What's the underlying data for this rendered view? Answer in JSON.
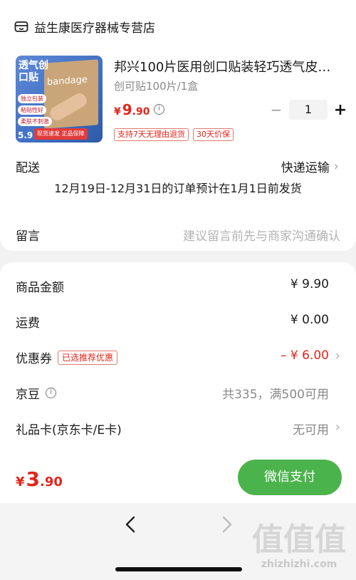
{
  "store": {
    "name": "益生康医疗器械专营店",
    "icon": "store-icon"
  },
  "product": {
    "image_text": {
      "title": "透气创口贴",
      "features": [
        "独立包装",
        "粘贴性好",
        "柔肤不刺激"
      ],
      "promo": "现货速发 正品保障",
      "brand": "bandage",
      "price_tag": "5.9"
    },
    "title": "邦兴100片医用创口贴装轻巧透气皮…",
    "spec": "创可贴100片/1盒",
    "price": {
      "yen": "¥",
      "int": "9",
      "dec": ".90"
    },
    "quantity": "1",
    "tags": [
      "支持7天无理由退货",
      "30天价保"
    ]
  },
  "shipping": {
    "label": "配送",
    "value": "快递运输",
    "note": "12月19日-12月31日的订单预计在1月1日前发货"
  },
  "memo": {
    "label": "留言",
    "placeholder": "建议留言前先与商家沟通确认"
  },
  "fees": {
    "goods": {
      "label": "商品金额",
      "value": "¥ 9.90"
    },
    "freight": {
      "label": "运费",
      "value": "¥ 0.00"
    },
    "coupon": {
      "label": "优惠券",
      "badge": "已选推荐优惠",
      "value": "– ¥ 6.00"
    },
    "jingdou": {
      "label": "京豆",
      "value": "共335，满500可用"
    },
    "giftcard": {
      "label": "礼品卡(京东卡/E卡)",
      "value": "无可用"
    }
  },
  "footer": {
    "total": {
      "yen": "¥",
      "int": "3",
      "dec": ".90"
    },
    "pay_label": "微信支付"
  },
  "watermark": {
    "logo": "值值值",
    "url": "zhizhizhi.com"
  },
  "colors": {
    "accent_red": "#e1251b",
    "pay_green": "#4bb34b"
  }
}
